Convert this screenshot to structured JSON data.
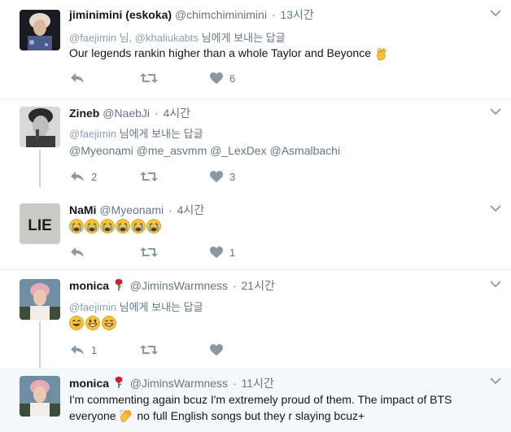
{
  "tweets": [
    {
      "name": "jiminimini (eskoka)",
      "handle": "@chimchiminimini",
      "time": "13시간",
      "reply_to": {
        "users": "@faejimin 님, @khaliukabts",
        "suffix": "님에게 보내는 답글"
      },
      "text": "Our legends rankin higher than a whole Taylor and Beyonce",
      "actions": {
        "reply": "",
        "retweet": "",
        "like": "6"
      }
    },
    {
      "name": "Zineb",
      "handle": "@NaebJi",
      "time": "4시간",
      "reply_to": {
        "users": "@faejimin",
        "suffix": "님에게 보내는 답글"
      },
      "text": "@Myeonami @me_asvmm @_LexDex @Asmalbachi",
      "actions": {
        "reply": "2",
        "retweet": "",
        "like": "3"
      }
    },
    {
      "name": "NaMi",
      "handle": "@Myeonami",
      "time": "4시간",
      "avatar_text": "LIE",
      "actions": {
        "reply": "",
        "retweet": "",
        "like": "1"
      }
    },
    {
      "name": "monica",
      "handle": "@JiminsWarmness",
      "time": "21시간",
      "reply_to": {
        "users": "@faejimin",
        "suffix": "님에게 보내는 답글"
      },
      "actions": {
        "reply": "1",
        "retweet": "",
        "like": ""
      }
    },
    {
      "name": "monica",
      "handle": "@JiminsWarmness",
      "time": "11시간",
      "text_line1": "I'm commenting again bcuz I'm extremely proud of them. The impact of BTS",
      "text_line2_a": "everyone",
      "text_line2_b": "no full English songs but they r slaying bcuz+"
    }
  ],
  "colors": {
    "icon": "#8899a6",
    "separator": "#e6ecf0",
    "thread_line": "#ccd6dd",
    "highlight_bg": "#f5f8fa"
  }
}
